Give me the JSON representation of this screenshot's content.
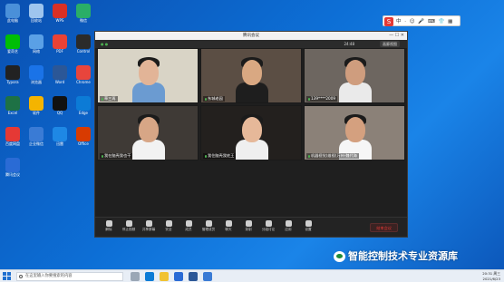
{
  "desktop": {
    "icons": [
      {
        "label": "此电脑",
        "color": "#4a90d9"
      },
      {
        "label": "回收站",
        "color": "#9ec5ee"
      },
      {
        "label": "WPS",
        "color": "#d93025"
      },
      {
        "label": "微信",
        "color": "#2aae67"
      },
      {
        "label": "爱奇艺",
        "color": "#00be06"
      },
      {
        "label": "网络",
        "color": "#5aa0e6"
      },
      {
        "label": "PDF",
        "color": "#e94235"
      },
      {
        "label": "Control",
        "color": "#2b2b2b"
      },
      {
        "label": "Typora",
        "color": "#222222"
      },
      {
        "label": "浏览器",
        "color": "#1a73e8"
      },
      {
        "label": "Word",
        "color": "#2b5797"
      },
      {
        "label": "Chrome",
        "color": "#e8453c"
      },
      {
        "label": "Excel",
        "color": "#1e7145"
      },
      {
        "label": "软件",
        "color": "#f4b400"
      },
      {
        "label": "QQ",
        "color": "#111111"
      },
      {
        "label": "Edge",
        "color": "#0c7bd6"
      },
      {
        "label": "百度网盘",
        "color": "#e53935"
      },
      {
        "label": "企业微信",
        "color": "#3a7bd5"
      },
      {
        "label": "迅雷",
        "color": "#1e88e5"
      },
      {
        "label": "Office",
        "color": "#d83b01"
      },
      {
        "label": "腾讯会议",
        "color": "#2a6bd5"
      }
    ]
  },
  "meeting": {
    "window_title": "腾讯会议",
    "window_controls": "— ☐ ✕",
    "signal_label": "● ●",
    "time": "24:48",
    "view_label": "画廊视图",
    "participants": [
      {
        "name": "草三再",
        "mic_on": true,
        "skin": "#e2b497",
        "shirt": "#6b9bd1",
        "bg": "#d9d4c6"
      },
      {
        "name": "东城老园",
        "mic_on": true,
        "skin": "#d9a882",
        "shirt": "#1e1e1e",
        "bg": "#5b4e44"
      },
      {
        "name": "139****2009",
        "mic_on": true,
        "skin": "#cf9d7e",
        "shirt": "#eaeaea",
        "bg": "#6d6660"
      },
      {
        "name": "我在脑壳我也干",
        "mic_on": true,
        "skin": "#d7a686",
        "shirt": "#f2f2f2",
        "bg": "#3f3a36"
      },
      {
        "name": "我住脑壳我姓王",
        "mic_on": true,
        "skin": "#e6b899",
        "shirt": "#efefef",
        "bg": "#23201e"
      },
      {
        "name": "机器视觉(维视)万州-魏代海",
        "mic_on": true,
        "skin": "#d4a07f",
        "shirt": "#f6f6f6",
        "bg": "#8b8178"
      }
    ],
    "toolbar": [
      {
        "label": "解除",
        "icon": "mic-icon"
      },
      {
        "label": "停止视频",
        "icon": "camera-icon"
      },
      {
        "label": "共享屏幕",
        "icon": "share-icon"
      },
      {
        "label": "安全",
        "icon": "shield-icon"
      },
      {
        "label": "成员",
        "icon": "members-icon"
      },
      {
        "label": "管理成员",
        "icon": "manage-icon"
      },
      {
        "label": "聊天",
        "icon": "chat-icon"
      },
      {
        "label": "录制",
        "icon": "record-icon"
      },
      {
        "label": "分组讨论",
        "icon": "breakout-icon"
      },
      {
        "label": "应用",
        "icon": "apps-icon"
      },
      {
        "label": "设置",
        "icon": "settings-icon"
      }
    ],
    "end_button": "结束会议"
  },
  "sogou_bar": {
    "logo": "S",
    "items": "中 · ☺ 🎤 ⌨ 👕 ▦"
  },
  "watermark": {
    "text": "智能控制技术专业资源库"
  },
  "taskbar": {
    "search_placeholder": "在这里输入你要搜索的内容",
    "clock_time": "20:31 周三",
    "clock_date": "2021/6/23",
    "colors": {
      "start": "#1e6fd0"
    }
  }
}
